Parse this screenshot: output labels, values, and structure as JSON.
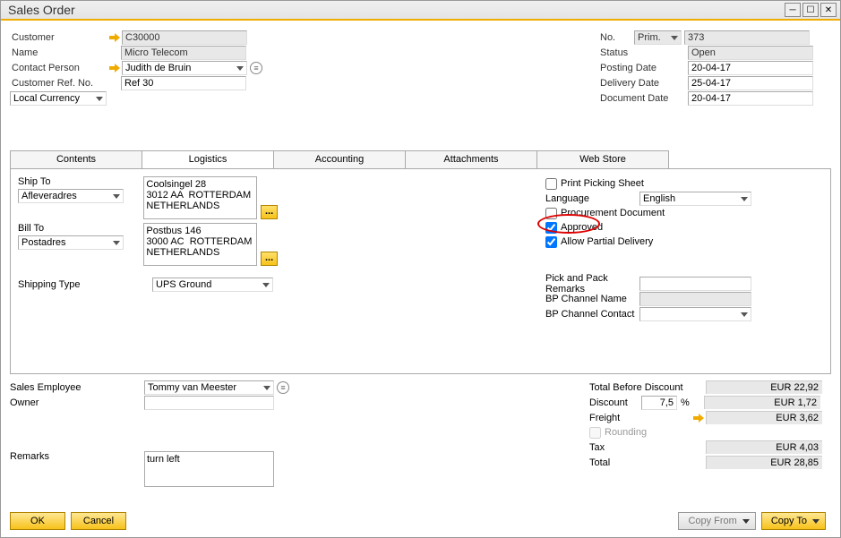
{
  "window": {
    "title": "Sales Order"
  },
  "header": {
    "left": {
      "customer_label": "Customer",
      "customer_value": "C30000",
      "name_label": "Name",
      "name_value": "Micro Telecom",
      "contact_label": "Contact Person",
      "contact_value": "Judith de Bruin",
      "ref_label": "Customer Ref. No.",
      "ref_value": "Ref 30",
      "currency_label": "Local Currency"
    },
    "right": {
      "no_label": "No.",
      "no_series": "Prim.",
      "no_value": "373",
      "status_label": "Status",
      "status_value": "Open",
      "posting_label": "Posting Date",
      "posting_value": "20-04-17",
      "delivery_label": "Delivery Date",
      "delivery_value": "25-04-17",
      "document_label": "Document Date",
      "document_value": "20-04-17"
    }
  },
  "tabs": {
    "contents": "Contents",
    "logistics": "Logistics",
    "accounting": "Accounting",
    "attachments": "Attachments",
    "webstore": "Web Store",
    "active": "logistics"
  },
  "logistics": {
    "shipto_label": "Ship To",
    "shipto_addr_type": "Afleveradres",
    "shipto_address": "Coolsingel 28\n3012 AA  ROTTERDAM\nNETHERLANDS",
    "billto_label": "Bill To",
    "billto_addr_type": "Postadres",
    "billto_address": "Postbus 146\n3000 AC  ROTTERDAM\nNETHERLANDS",
    "shiptype_label": "Shipping Type",
    "shiptype_value": "UPS Ground",
    "print_picking": "Print Picking Sheet",
    "language_label": "Language",
    "language_value": "English",
    "procurement": "Procurement Document",
    "approved": "Approved",
    "partial": "Allow Partial Delivery",
    "pickpack_label": "Pick and Pack Remarks",
    "bp_channel_name": "BP Channel Name",
    "bp_channel_contact": "BP Channel Contact"
  },
  "footer_section": {
    "salesemp_label": "Sales Employee",
    "salesemp_value": "Tommy van Meester",
    "owner_label": "Owner",
    "remarks_label": "Remarks",
    "remarks_value": "turn left"
  },
  "totals": {
    "before_label": "Total Before Discount",
    "before_value": "EUR 22,92",
    "discount_label": "Discount",
    "discount_pct": "7,5",
    "pct": "%",
    "discount_value": "EUR 1,72",
    "freight_label": "Freight",
    "freight_value": "EUR 3,62",
    "rounding_label": "Rounding",
    "tax_label": "Tax",
    "tax_value": "EUR 4,03",
    "total_label": "Total",
    "total_value": "EUR 28,85"
  },
  "buttons": {
    "ok": "OK",
    "cancel": "Cancel",
    "copyfrom": "Copy From",
    "copyto": "Copy To"
  },
  "dots": "..."
}
